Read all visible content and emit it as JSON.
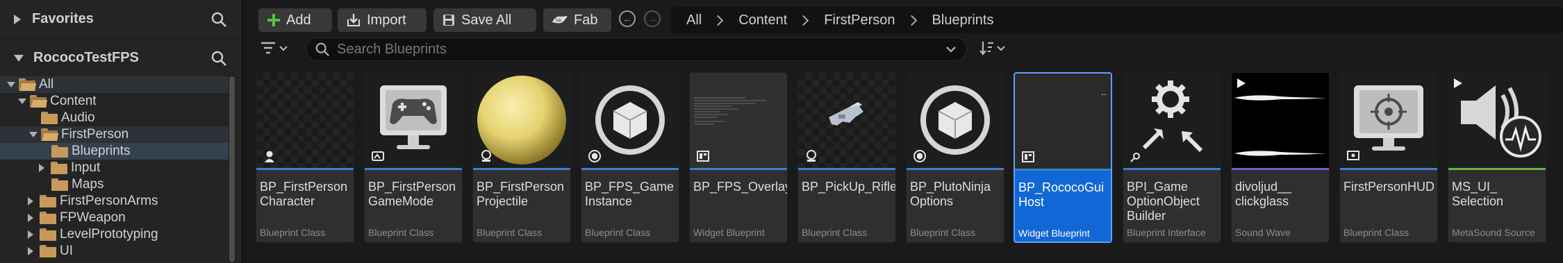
{
  "left_panel": {
    "favorites_label": "Favorites",
    "project_label": "RococoTestFPS",
    "tree": [
      {
        "label": "All",
        "depth": 0,
        "expanded": true
      },
      {
        "label": "Content",
        "depth": 1,
        "expanded": true
      },
      {
        "label": "Audio",
        "depth": 2,
        "expanded": false
      },
      {
        "label": "FirstPerson",
        "depth": 2,
        "expanded": true
      },
      {
        "label": "Blueprints",
        "depth": 3,
        "selected": true
      },
      {
        "label": "Input",
        "depth": 3,
        "expanded": false
      },
      {
        "label": "Maps",
        "depth": 3,
        "expanded": false
      },
      {
        "label": "FirstPersonArms",
        "depth": 2,
        "expanded": false
      },
      {
        "label": "FPWeapon",
        "depth": 2,
        "expanded": false
      },
      {
        "label": "LevelPrototyping",
        "depth": 2,
        "expanded": false
      },
      {
        "label": "UI",
        "depth": 2,
        "expanded": false
      }
    ]
  },
  "toolbar": {
    "add_label": "Add",
    "import_label": "Import",
    "save_all_label": "Save All",
    "fab_label": "Fab"
  },
  "breadcrumb": [
    "All",
    "Content",
    "FirstPerson",
    "Blueprints"
  ],
  "search": {
    "placeholder": "Search Blueprints",
    "value": ""
  },
  "assets": [
    {
      "name": "BP_FirstPerson\nCharacter",
      "type": "Blueprint Class",
      "thumb": "checker-character-icon",
      "accent": "#3d7fd0"
    },
    {
      "name": "BP_FirstPerson\nGameMode",
      "type": "Blueprint Class",
      "thumb": "gamepad-monitor-icon",
      "accent": "#3d7fd0"
    },
    {
      "name": "BP_FirstPerson\nProjectile",
      "type": "Blueprint Class",
      "thumb": "yellow-sphere-icon",
      "accent": "#3d7fd0"
    },
    {
      "name": "BP_FPS_Game\nInstance",
      "type": "Blueprint Class",
      "thumb": "cube-circle-icon",
      "accent": "#3d7fd0"
    },
    {
      "name": "BP_FPS_Overlay",
      "type": "Widget Blueprint",
      "thumb": "text-preview-icon",
      "accent": "#3d7fd0"
    },
    {
      "name": "BP_PickUp_Rifle",
      "type": "Blueprint Class",
      "thumb": "rifle-icon",
      "accent": "#3d7fd0"
    },
    {
      "name": "BP_PlutoNinja\nOptions",
      "type": "Blueprint Class",
      "thumb": "cube-circle-icon",
      "accent": "#3d7fd0"
    },
    {
      "name": "BP_RococoGui\nHost",
      "type": "Widget Blueprint",
      "thumb": "widget-icon",
      "accent": "#3d7fd0",
      "selected": true
    },
    {
      "name": "BPI_Game\nOptionObject\nBuilder",
      "type": "Blueprint Interface",
      "thumb": "gear-arrows-icon",
      "accent": "#3d7fd0"
    },
    {
      "name": "divoljud__\nclickglass",
      "type": "Sound Wave",
      "thumb": "waveform-icon",
      "accent": "#7a5ac8"
    },
    {
      "name": "FirstPersonHUD",
      "type": "Blueprint Class",
      "thumb": "hud-monitor-icon",
      "accent": "#3d7fd0"
    },
    {
      "name": "MS_UI_\nSelection",
      "type": "MetaSound Source",
      "thumb": "speaker-icon",
      "accent": "#6ab63c"
    }
  ]
}
